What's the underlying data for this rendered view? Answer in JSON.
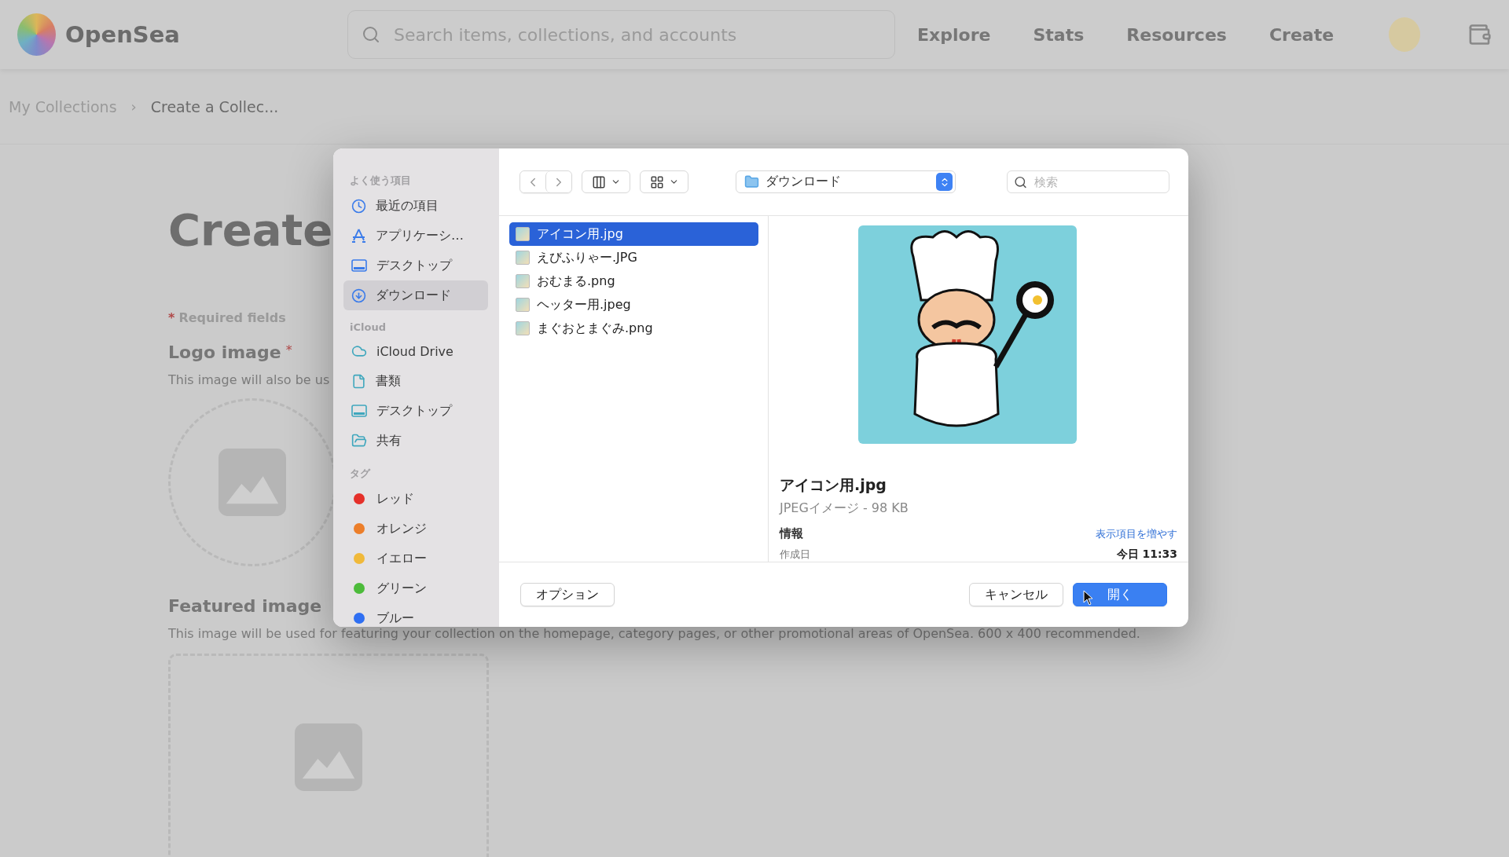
{
  "header": {
    "logo_text": "OpenSea",
    "search_placeholder": "Search items, collections, and accounts",
    "nav": [
      "Explore",
      "Stats",
      "Resources",
      "Create"
    ]
  },
  "breadcrumb": {
    "items": [
      "My Collections",
      "Create a Collec..."
    ],
    "separator": "›"
  },
  "page": {
    "heading": "Create",
    "required_mark": "*",
    "required_note": "Required fields",
    "logo_section": {
      "title": "Logo image",
      "required_mark": "*",
      "description": "This image will also be us"
    },
    "featured_section": {
      "title": "Featured image",
      "description": "This image will be used for featuring your collection on the homepage, category pages, or other promotional areas of OpenSea. 600 x 400 recommended."
    }
  },
  "dialog": {
    "sidebar": [
      {
        "title": "よく使う項目",
        "items": [
          {
            "label": "最近の項目",
            "kind": "clock",
            "selected": false
          },
          {
            "label": "アプリケーシ…",
            "kind": "apps",
            "selected": false
          },
          {
            "label": "デスクトップ",
            "kind": "desktop",
            "selected": false
          },
          {
            "label": "ダウンロード",
            "kind": "download",
            "selected": true
          }
        ]
      },
      {
        "title": "iCloud",
        "items": [
          {
            "label": "iCloud Drive",
            "kind": "cloud",
            "selected": false
          },
          {
            "label": "書類",
            "kind": "document",
            "selected": false
          },
          {
            "label": "デスクトップ",
            "kind": "desktop-cloud",
            "selected": false
          },
          {
            "label": "共有",
            "kind": "shared",
            "selected": false
          }
        ]
      }
    ],
    "tags": {
      "title": "タグ",
      "items": [
        {
          "label": "レッド",
          "color": "#e5302a"
        },
        {
          "label": "オレンジ",
          "color": "#ec7e2a"
        },
        {
          "label": "イエロー",
          "color": "#f0b93a"
        },
        {
          "label": "グリーン",
          "color": "#4cbb3a"
        },
        {
          "label": "ブルー",
          "color": "#2f6ff2"
        }
      ]
    },
    "location": "ダウンロード",
    "search_placeholder": "検索",
    "files": [
      {
        "name": "アイコン用.jpg",
        "selected": true
      },
      {
        "name": "えびふりゃー.JPG",
        "selected": false
      },
      {
        "name": "おむまる.png",
        "selected": false
      },
      {
        "name": "ヘッター用.jpeg",
        "selected": false
      },
      {
        "name": "まぐおとまぐみ.png",
        "selected": false
      }
    ],
    "preview": {
      "name": "アイコン用.jpg",
      "kind_size": "JPEGイメージ - 98 KB",
      "info_label": "情報",
      "more_link": "表示項目を増やす",
      "created_label": "作成日",
      "created_value": "今日 11:33"
    },
    "buttons": {
      "options": "オプション",
      "cancel": "キャンセル",
      "open": "開く"
    }
  }
}
